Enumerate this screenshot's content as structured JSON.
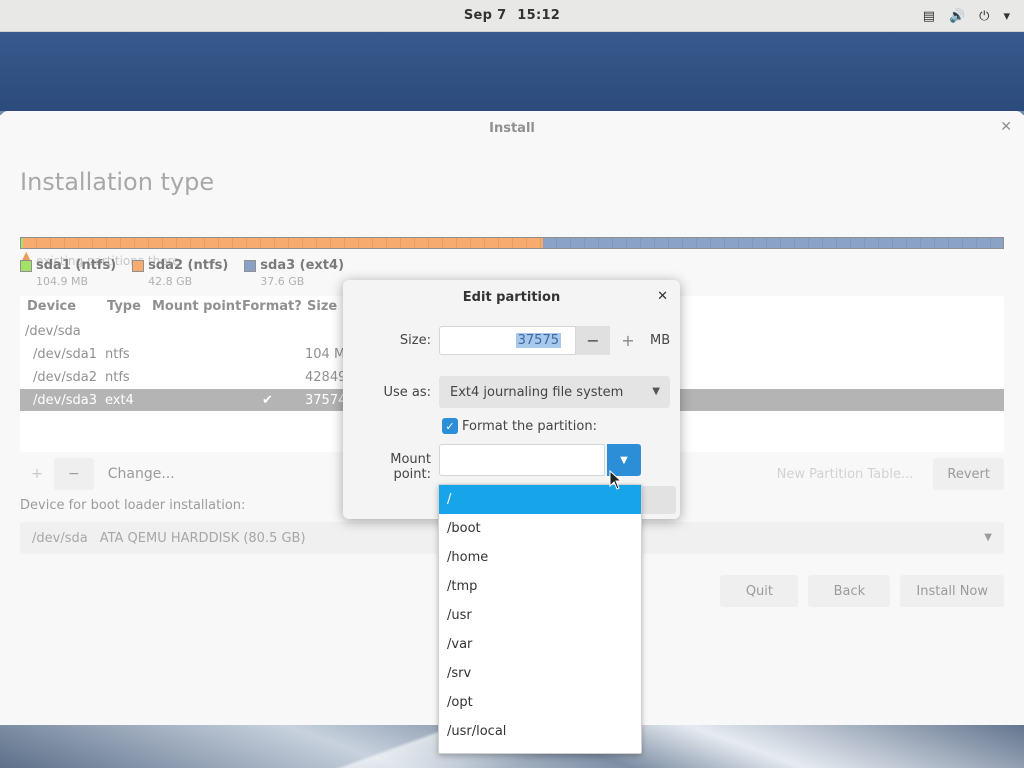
{
  "topbar": {
    "date": "Sep 7",
    "time": "15:12",
    "tray_icons": [
      "network-icon",
      "volume-icon",
      "power-icon",
      "chevron-down-icon"
    ]
  },
  "window": {
    "title": "Install",
    "page_title": "Installation type",
    "ghost_text": "existing partitions there",
    "legend": [
      {
        "name": "sda1 (ntfs)",
        "size": "104.9 MB",
        "color": "#73d216"
      },
      {
        "name": "sda2 (ntfs)",
        "size": "42.8 GB",
        "color": "#f47e22"
      },
      {
        "name": "sda3 (ext4)",
        "size": "37.6 GB",
        "color": "#4a70a6"
      }
    ],
    "table": {
      "headers": {
        "device": "Device",
        "type": "Type",
        "mount": "Mount point",
        "format": "Format?",
        "size": "Size"
      },
      "rows": [
        {
          "device": "/dev/sda",
          "type": "",
          "format": "",
          "size": ""
        },
        {
          "device": "/dev/sda1",
          "type": "ntfs",
          "format": "",
          "size": "104 M"
        },
        {
          "device": "/dev/sda2",
          "type": "ntfs",
          "format": "",
          "size": "42849"
        },
        {
          "device": "/dev/sda3",
          "type": "ext4",
          "format": "✔",
          "size": "37574"
        }
      ]
    },
    "toolbar": {
      "add": "+",
      "remove": "−",
      "change": "Change...",
      "new_table": "New Partition Table...",
      "revert": "Revert"
    },
    "boot": {
      "label": "Device for boot loader installation:",
      "device": "/dev/sda",
      "description": "ATA QEMU HARDDISK (80.5 GB)"
    },
    "footer": {
      "quit": "Quit",
      "back": "Back",
      "install": "Install Now"
    }
  },
  "dialog": {
    "title": "Edit partition",
    "size_label": "Size:",
    "size_value": "37575",
    "minus": "−",
    "plus": "+",
    "unit": "MB",
    "use_as_label": "Use as:",
    "use_as_value": "Ext4 journaling file system",
    "format_label": "Format the partition:",
    "format_checked": true,
    "mount_label": "Mount point:",
    "mount_value": ""
  },
  "mount_options": [
    "/",
    "/boot",
    "/home",
    "/tmp",
    "/usr",
    "/var",
    "/srv",
    "/opt",
    "/usr/local"
  ]
}
